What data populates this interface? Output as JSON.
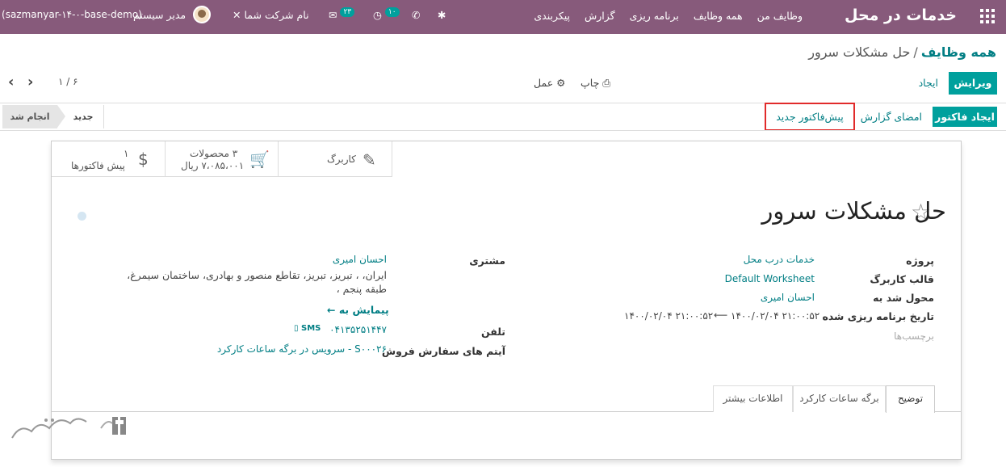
{
  "navbar": {
    "brand": "خدمات در محل",
    "menu": [
      "وظایف من",
      "همه وظایف",
      "برنامه ریزی",
      "گزارش",
      "پیکربندی"
    ],
    "company": "نام شرکت شما",
    "user": "مدیر سیستم",
    "database": "(sazmanyar-۱۴-۰-base-demo)",
    "activity_count": "۱۰",
    "message_count": "۲۳",
    "accent": "#875a7b"
  },
  "breadcrumb": {
    "parent": "همه وظایف",
    "current": "حل مشکلات سرور"
  },
  "toolbar": {
    "edit": "ویرایش",
    "create": "ایجاد",
    "print": "چاپ",
    "action": "عمل",
    "pager": "۱ / ۶"
  },
  "statusbar": {
    "create_invoice": "ایجاد فاکتور",
    "sign_report": "امضای گزارش",
    "new_quotation": "پیش‌فاکتور جدید",
    "stages": [
      "جدید",
      "انجام شد"
    ]
  },
  "smart_buttons": {
    "worksheet": "کاربرگ",
    "products_count": "۳ محصولات",
    "products_amount": "۷،۰۸۵،۰۰۱ ریال",
    "quotations_count": "۱",
    "quotations_label": "پیش فاکتورها"
  },
  "task": {
    "title": "حل مشکلات سرور",
    "fields_right": {
      "project_label": "پروژه",
      "project_value": "خدمات درب محل",
      "worksheet_label": "قالب کاربرگ",
      "worksheet_value": "Default Worksheet",
      "assigned_label": "محول شد به",
      "assigned_value": "احسان امیری",
      "planned_label": "تاریخ برنامه ریزی شده",
      "planned_start": "۱۴۰۰/۰۲/۰۴ ۲۱:۰۰:۵۲",
      "planned_end": "۱۴۰۰/۰۲/۰۴ ۲۱:۰۰:۵۲",
      "tags_placeholder": "برچسب‌ها"
    },
    "fields_left": {
      "customer_label": "مشتری",
      "customer_name": "احسان امیری",
      "customer_address": "ایران، ، تبریز، تبریز، تقاطع منصور و بهادری، ساختمان سیمرغ، طبقه پنجم ،",
      "navigate": "پیمایش به",
      "phone_label": "تلفن",
      "phone_value": "۰۴۱۳۵۲۵۱۴۴۷",
      "sms": "SMS",
      "so_item_label": "آیتم های سفارش فروش",
      "so_item_value": "S۰۰۰۲۶ - سرویس در برگه ساعات کارکرد"
    }
  },
  "tabs": [
    "توضیح",
    "برگه ساعات کارکرد",
    "اطلاعات بیشتر"
  ]
}
